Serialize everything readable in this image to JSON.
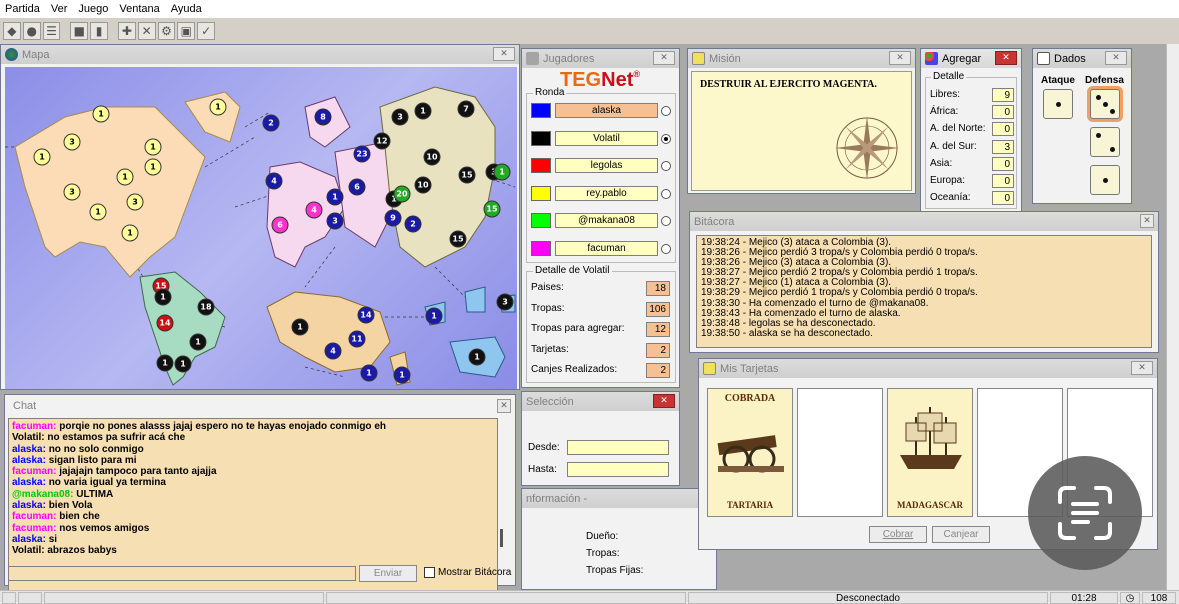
{
  "menu": [
    "Partida",
    "Ver",
    "Juego",
    "Ventana",
    "Ayuda"
  ],
  "toolbar": {
    "icons": [
      "connect-icon",
      "disconnect-icon",
      "list-icon",
      "stop-icon",
      "pause-icon",
      "add-icon",
      "cancel-icon",
      "settings-icon",
      "layout-icon",
      "check-icon"
    ]
  },
  "map_window": {
    "title": "Mapa"
  },
  "map_tokens": [
    {
      "color": "#ffff99",
      "fg": "#000",
      "label": "1"
    },
    {
      "color": "#ffff99",
      "fg": "#000",
      "label": "1"
    },
    {
      "color": "#ffff99",
      "fg": "#000",
      "label": "1"
    },
    {
      "color": "#ffff99",
      "fg": "#000",
      "label": "3"
    },
    {
      "color": "#ffff99",
      "fg": "#000",
      "label": "1"
    },
    {
      "color": "#ffff99",
      "fg": "#000",
      "label": "1"
    },
    {
      "color": "#ffff99",
      "fg": "#000",
      "label": "1"
    },
    {
      "color": "#ffff99",
      "fg": "#000",
      "label": "3"
    },
    {
      "color": "#ffff99",
      "fg": "#000",
      "label": "3"
    },
    {
      "color": "#ffff99",
      "fg": "#000",
      "label": "1"
    },
    {
      "color": "#ffff99",
      "fg": "#000",
      "label": "1"
    },
    {
      "color": "#1a1aa6",
      "fg": "#fff",
      "label": "2"
    },
    {
      "color": "#1a1aa6",
      "fg": "#fff",
      "label": "8"
    },
    {
      "color": "#1a1aa6",
      "fg": "#fff",
      "label": "23"
    },
    {
      "color": "#1a1aa6",
      "fg": "#fff",
      "label": "4"
    },
    {
      "color": "#1a1aa6",
      "fg": "#fff",
      "label": "6"
    },
    {
      "color": "#1a1aa6",
      "fg": "#fff",
      "label": "1"
    },
    {
      "color": "#1a1aa6",
      "fg": "#fff",
      "label": "3"
    },
    {
      "color": "#1a1aa6",
      "fg": "#fff",
      "label": "9"
    },
    {
      "color": "#1a1aa6",
      "fg": "#fff",
      "label": "2"
    },
    {
      "color": "#ff33cc",
      "fg": "#fff",
      "label": "4"
    },
    {
      "color": "#ff33cc",
      "fg": "#fff",
      "label": "6"
    },
    {
      "color": "#111",
      "fg": "#fff",
      "label": "3"
    },
    {
      "color": "#111",
      "fg": "#fff",
      "label": "1"
    },
    {
      "color": "#111",
      "fg": "#fff",
      "label": "7"
    },
    {
      "color": "#111",
      "fg": "#fff",
      "label": "12"
    },
    {
      "color": "#111",
      "fg": "#fff",
      "label": "10"
    },
    {
      "color": "#111",
      "fg": "#fff",
      "label": "10"
    },
    {
      "color": "#111",
      "fg": "#fff",
      "label": "15"
    },
    {
      "color": "#111",
      "fg": "#fff",
      "label": "15"
    },
    {
      "color": "#111",
      "fg": "#fff",
      "label": "3"
    },
    {
      "color": "#111",
      "fg": "#fff",
      "label": "1"
    },
    {
      "color": "#22aa22",
      "fg": "#fff",
      "label": "20"
    },
    {
      "color": "#22aa22",
      "fg": "#fff",
      "label": "1"
    },
    {
      "color": "#22aa22",
      "fg": "#fff",
      "label": "15"
    },
    {
      "color": "#cc1111",
      "fg": "#fff",
      "label": "15"
    },
    {
      "color": "#cc1111",
      "fg": "#fff",
      "label": "14"
    },
    {
      "color": "#111",
      "fg": "#fff",
      "label": "18"
    },
    {
      "color": "#111",
      "fg": "#fff",
      "label": "1"
    },
    {
      "color": "#111",
      "fg": "#fff",
      "label": "1"
    },
    {
      "color": "#111",
      "fg": "#fff",
      "label": "1"
    },
    {
      "color": "#111",
      "fg": "#fff",
      "label": "1"
    },
    {
      "color": "#111",
      "fg": "#fff",
      "label": "1"
    },
    {
      "color": "#1a1aa6",
      "fg": "#fff",
      "label": "14"
    },
    {
      "color": "#1a1aa6",
      "fg": "#fff",
      "label": "11"
    },
    {
      "color": "#1a1aa6",
      "fg": "#fff",
      "label": "4"
    },
    {
      "color": "#1a1aa6",
      "fg": "#fff",
      "label": "1"
    },
    {
      "color": "#1a1aa6",
      "fg": "#fff",
      "label": "1"
    },
    {
      "color": "#1a1aa6",
      "fg": "#fff",
      "label": "1"
    },
    {
      "color": "#111",
      "fg": "#fff",
      "label": "3"
    },
    {
      "color": "#111",
      "fg": "#fff",
      "label": "1"
    },
    {
      "color": "#111",
      "fg": "#fff",
      "label": "3"
    }
  ],
  "players_window": {
    "title": "Jugadores",
    "logo_teg": "TEG",
    "logo_net": "Net",
    "ronda_label": "Ronda",
    "players": [
      {
        "name": "alaska",
        "color": "#0000ff",
        "active": false,
        "highlight": true
      },
      {
        "name": "Volatil",
        "color": "#000000",
        "active": true,
        "highlight": false
      },
      {
        "name": "legolas",
        "color": "#ff0000",
        "active": false,
        "highlight": false
      },
      {
        "name": "rey.pablo",
        "color": "#ffff00",
        "active": false,
        "highlight": false
      },
      {
        "name": "@makana08",
        "color": "#00ff00",
        "active": false,
        "highlight": false
      },
      {
        "name": "facuman",
        "color": "#ff00ff",
        "active": false,
        "highlight": false
      }
    ],
    "detail_title": "Detalle de Volatil",
    "details": [
      {
        "label": "Paises:",
        "value": "18"
      },
      {
        "label": "Tropas:",
        "value": "106"
      },
      {
        "label": "Tropas para agregar:",
        "value": "12"
      },
      {
        "label": "Tarjetas:",
        "value": "2"
      },
      {
        "label": "Canjes Realizados:",
        "value": "2"
      }
    ]
  },
  "mission_window": {
    "title": "Misión",
    "text": "DESTRUIR AL EJERCITO MAGENTA."
  },
  "agregar_window": {
    "title": "Agregar",
    "group": "Detalle",
    "rows": [
      {
        "label": "Libres:",
        "value": "9"
      },
      {
        "label": "África:",
        "value": "0"
      },
      {
        "label": "A. del Norte:",
        "value": "0"
      },
      {
        "label": "A. del Sur:",
        "value": "3"
      },
      {
        "label": "Asia:",
        "value": "0"
      },
      {
        "label": "Europa:",
        "value": "0"
      },
      {
        "label": "Oceanía:",
        "value": "0"
      }
    ]
  },
  "dados_window": {
    "title": "Dados",
    "ataque": "Ataque",
    "defensa": "Defensa",
    "attack_dice": [
      1
    ],
    "defense_dice": [
      3,
      2,
      1
    ]
  },
  "bitacora_window": {
    "title": "Bitácora",
    "lines": [
      "19:38:24 - Mejico (3) ataca a Colombia (3).",
      "19:38:26 - Mejico perdió 3 tropa/s y Colombia perdió 0 tropa/s.",
      "19:38:26 - Mejico (3) ataca a Colombia (3).",
      "19:38:27 - Mejico perdió 2 tropa/s y Colombia perdió 1 tropa/s.",
      "19:38:27 - Mejico (1) ataca a Colombia (3).",
      "19:38:29 - Mejico perdió 1 tropa/s y Colombia perdió 0 tropa/s.",
      "19:38:30 - Ha comenzado el turno de @makana08.",
      "19:38:43 - Ha comenzado el turno de alaska.",
      "19:38:48 - legolas se ha desconectado.",
      "19:38:50 - alaska se ha desconectado."
    ]
  },
  "tarjetas_window": {
    "title": "Mis Tarjetas",
    "cards": [
      {
        "type": "COBRADA",
        "country": "TARTARIA"
      },
      {
        "type": "",
        "country": ""
      },
      {
        "type": "",
        "country": "MADAGASCAR"
      },
      {
        "type": "",
        "country": ""
      },
      {
        "type": "",
        "country": ""
      }
    ],
    "cobrar": "Cobrar",
    "canjear": "Canjear"
  },
  "chat_window": {
    "title": "Chat",
    "lines": [
      {
        "user": "facuman",
        "color": "#ff00ff",
        "text": "porqie no pones alasss jajaj espero no te hayas enojado conmigo eh"
      },
      {
        "user": "Volatil",
        "color": "#000000",
        "text": "no estamos pa sufrir acá che"
      },
      {
        "user": "alaska",
        "color": "#0000ff",
        "text": "no no solo conmigo"
      },
      {
        "user": "alaska",
        "color": "#0000ff",
        "text": "sigan listo para mi"
      },
      {
        "user": "facuman",
        "color": "#ff00ff",
        "text": "jajajajn tampoco para tanto ajajja"
      },
      {
        "user": "alaska",
        "color": "#0000ff",
        "text": "no varia igual ya termina"
      },
      {
        "user": "@makana08",
        "color": "#00cc00",
        "text": "ULTIMA"
      },
      {
        "user": "alaska",
        "color": "#0000ff",
        "text": "bien Vola"
      },
      {
        "user": "facuman",
        "color": "#ff00ff",
        "text": "bien che"
      },
      {
        "user": "facuman",
        "color": "#ff00ff",
        "text": "nos vemos amigos"
      },
      {
        "user": "alaska",
        "color": "#0000ff",
        "text": "si"
      },
      {
        "user": "Volatil",
        "color": "#000000",
        "text": "abrazos babys"
      }
    ],
    "send": "Enviar",
    "show_log": "Mostrar Bitácora"
  },
  "seleccion_window": {
    "title": "Selección",
    "desde": "Desde:",
    "hasta": "Hasta:"
  },
  "info_window": {
    "title": "nformación -",
    "dueno": "Dueño:",
    "tropas": "Tropas:",
    "fijas": "Tropas Fijas:"
  },
  "status": {
    "connection": "Desconectado",
    "time": "01:28",
    "count": "108"
  }
}
